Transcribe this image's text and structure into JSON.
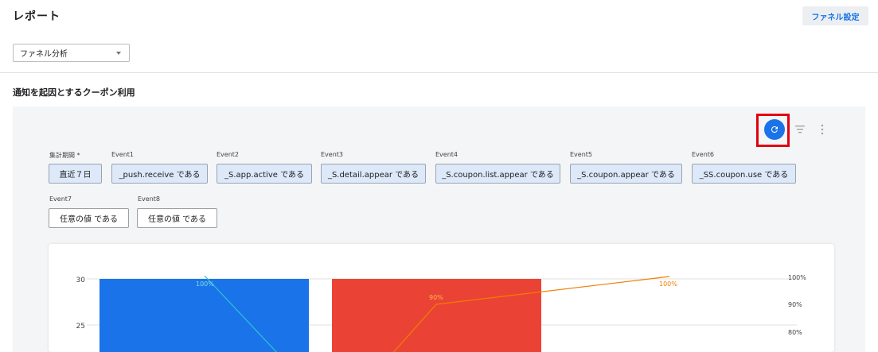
{
  "header": {
    "title": "レポート",
    "funnel_settings_label": "ファネル設定"
  },
  "analysis_select": {
    "value": "ファネル分析"
  },
  "section": {
    "title": "通知を起因とするクーポン利用"
  },
  "toolbar": {
    "refresh_icon": "refresh-icon",
    "filter_icon": "filter-icon",
    "more_icon": "more-vert-icon"
  },
  "filters": {
    "period": {
      "label": "集計期間 *",
      "value": "直近７日"
    },
    "events": [
      {
        "label": "Event1",
        "value": "_push.receive である"
      },
      {
        "label": "Event2",
        "value": "_S.app.active である"
      },
      {
        "label": "Event3",
        "value": "_S.detail.appear である"
      },
      {
        "label": "Event4",
        "value": "_S.coupon.list.appear である"
      },
      {
        "label": "Event5",
        "value": "_S.coupon.appear である"
      },
      {
        "label": "Event6",
        "value": "_SS.coupon.use である"
      },
      {
        "label": "Event7",
        "value": "任意の値 である"
      },
      {
        "label": "Event8",
        "value": "任意の値 である"
      }
    ]
  },
  "colors": {
    "accent": "#1a73e8",
    "bar_blue": "#1a73e8",
    "bar_red": "#ea4335",
    "line_teal": "#26c6da",
    "line_orange": "#f57c00",
    "highlight_red": "#e3000f"
  },
  "chart_data": {
    "type": "bar",
    "y_ticks_left": [
      "30",
      "25"
    ],
    "y_ticks_right": [
      "100%",
      "90%",
      "80%"
    ],
    "bars": [
      {
        "series_color": "blue",
        "value": 30
      },
      {
        "series_color": "red",
        "value": 30
      }
    ],
    "lines": [
      {
        "color": "teal",
        "labels": [
          "100%"
        ]
      },
      {
        "color": "orange",
        "labels": [
          "90%",
          "100%"
        ]
      }
    ]
  }
}
